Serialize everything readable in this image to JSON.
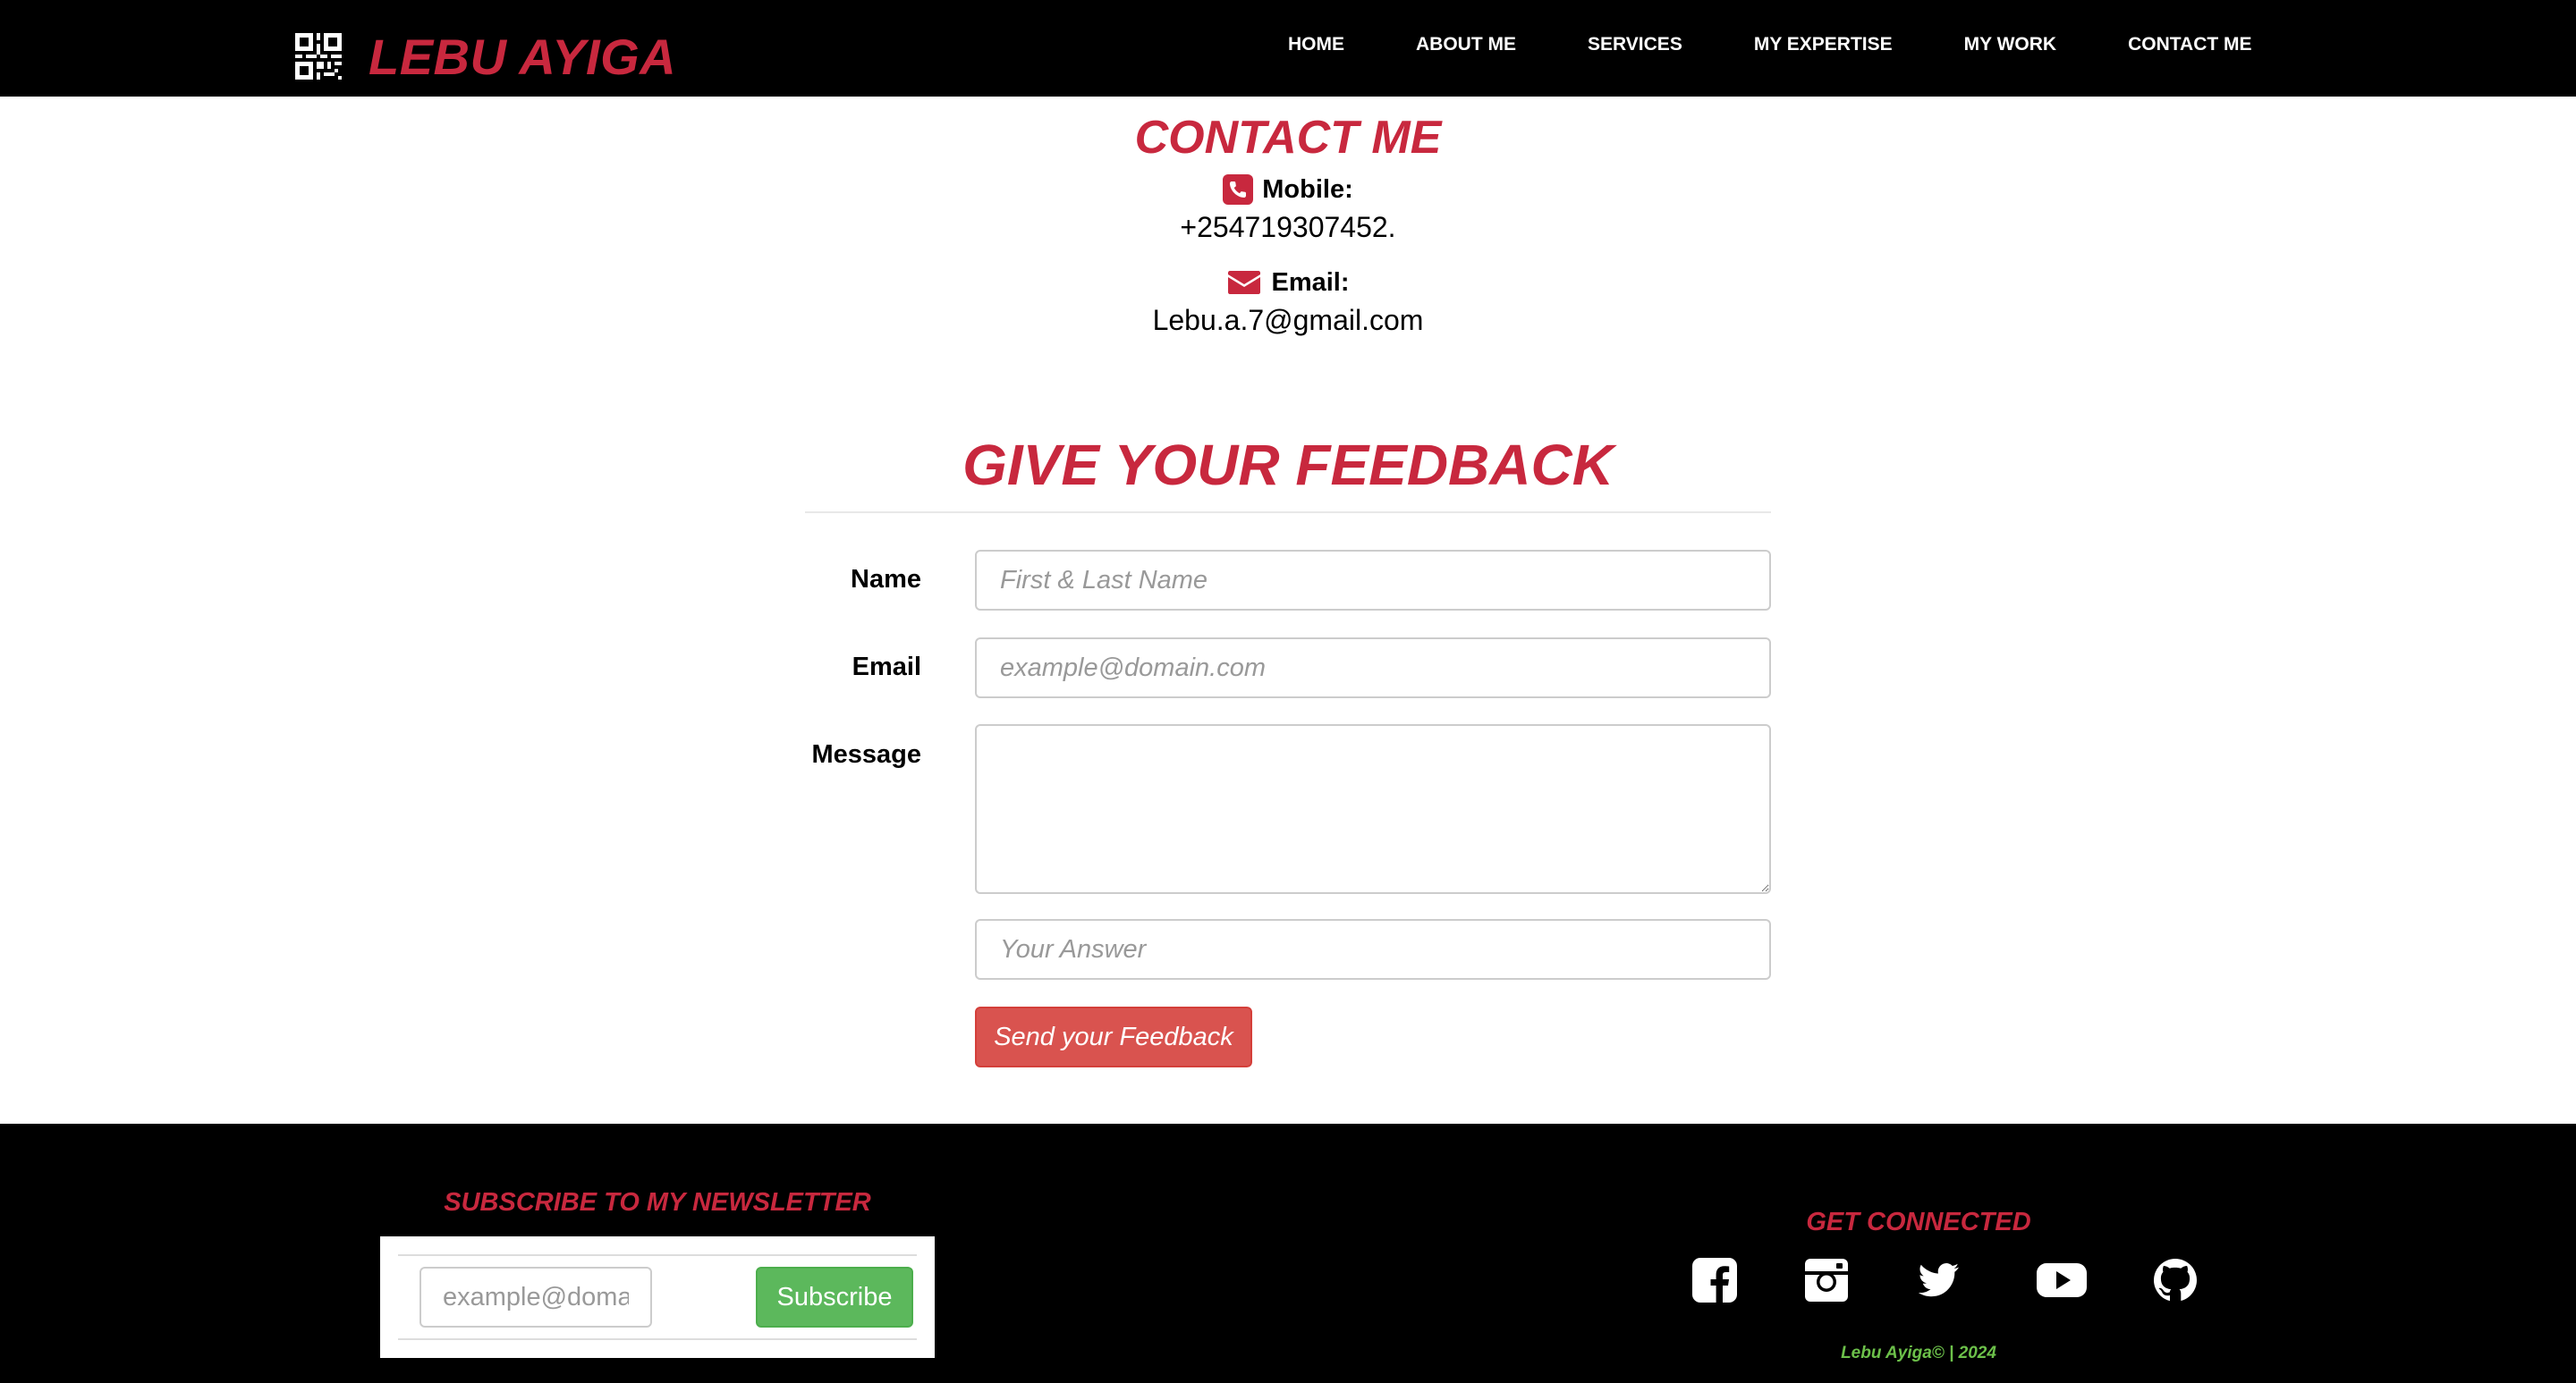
{
  "brand": {
    "name": "LEBU AYIGA",
    "logo_icon": "qr-code-icon"
  },
  "nav": {
    "items": [
      {
        "label": "HOME"
      },
      {
        "label": "ABOUT ME"
      },
      {
        "label": "SERVICES"
      },
      {
        "label": "MY EXPERTISE"
      },
      {
        "label": "MY WORK"
      },
      {
        "label": "CONTACT ME"
      }
    ]
  },
  "contact": {
    "title": "CONTACT ME",
    "mobile_label": "Mobile:",
    "mobile_value": "+254719307452.",
    "mobile_icon": "phone-icon",
    "email_label": "Email:",
    "email_value": "Lebu.a.7@gmail.com",
    "email_icon": "envelope-icon"
  },
  "feedback": {
    "title": "GIVE YOUR FEEDBACK",
    "name_label": "Name",
    "name_placeholder": "First & Last Name",
    "email_label": "Email",
    "email_placeholder": "example@domain.com",
    "message_label": "Message",
    "answer_placeholder": "Your Answer",
    "submit_label": "Send your Feedback"
  },
  "footer": {
    "newsletter_title": "SUBSCRIBE TO MY NEWSLETTER",
    "newsletter_placeholder": "example@domain.com",
    "subscribe_label": "Subscribe",
    "connect_title": "GET CONNECTED",
    "social_icons": [
      "facebook-icon",
      "instagram-icon",
      "twitter-icon",
      "youtube-icon",
      "github-icon"
    ],
    "copyright": "Lebu Ayiga© | 2024"
  },
  "colors": {
    "accent_red": "#c8283e",
    "button_red": "#d9534f",
    "button_green": "#5cb85c",
    "copyright_green": "#6cc04a",
    "nav_bg": "#000000"
  }
}
